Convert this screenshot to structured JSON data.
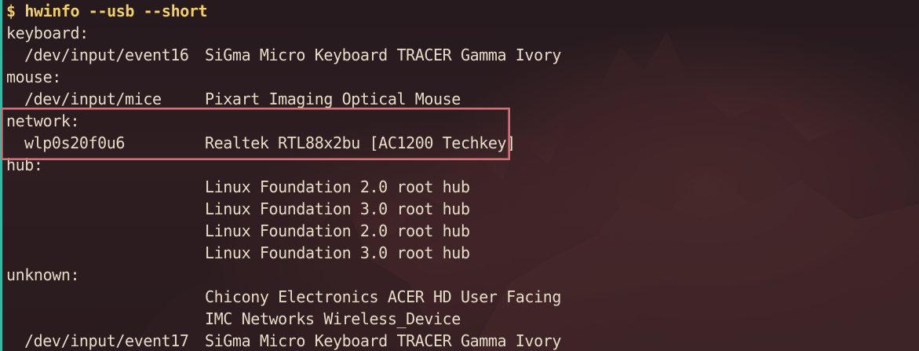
{
  "terminal": {
    "prompt_symbol": "$",
    "command": "hwinfo --usb --short",
    "sections": [
      {
        "id": "keyboard",
        "header": "keyboard:",
        "entries": [
          {
            "device": "/dev/input/event16",
            "description": "SiGma Micro Keyboard TRACER Gamma Ivory"
          }
        ]
      },
      {
        "id": "mouse",
        "header": "mouse:",
        "entries": [
          {
            "device": "/dev/input/mice",
            "description": "Pixart Imaging Optical Mouse"
          }
        ]
      },
      {
        "id": "network",
        "header": "network:",
        "entries": [
          {
            "device": "wlp0s20f0u6",
            "description": "Realtek RTL88x2bu [AC1200 Techkey]"
          }
        ]
      },
      {
        "id": "hub",
        "header": "hub:",
        "entries": [
          {
            "device": "",
            "description": "Linux Foundation 2.0 root hub"
          },
          {
            "device": "",
            "description": "Linux Foundation 3.0 root hub"
          },
          {
            "device": "",
            "description": "Linux Foundation 2.0 root hub"
          },
          {
            "device": "",
            "description": "Linux Foundation 3.0 root hub"
          }
        ]
      },
      {
        "id": "unknown",
        "header": "unknown:",
        "entries": [
          {
            "device": "",
            "description": "Chicony Electronics ACER HD User Facing"
          },
          {
            "device": "",
            "description": "IMC Networks Wireless_Device"
          },
          {
            "device": "/dev/input/event17",
            "description": "SiGma Micro Keyboard TRACER Gamma Ivory"
          }
        ]
      }
    ]
  },
  "colors": {
    "text": "#e6dcc8",
    "prompt": "#f2cf6a",
    "highlight_border": "#e06a72",
    "edge_accent": "#35b8a6"
  },
  "annotation": {
    "highlighted_section": "network"
  }
}
